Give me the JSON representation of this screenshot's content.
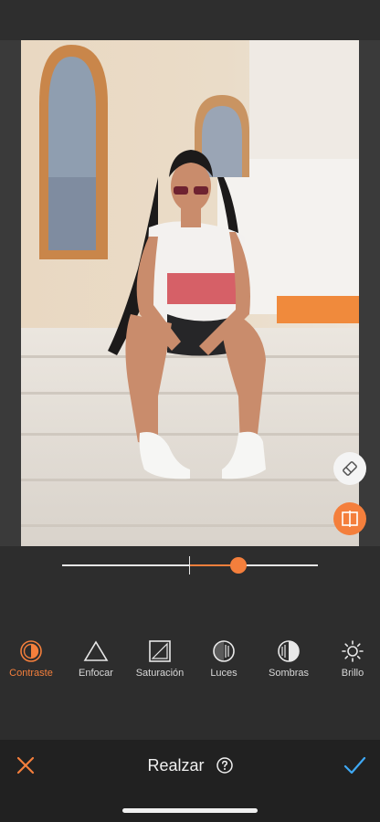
{
  "editor": {
    "title": "Realzar",
    "accent_color": "#f47f3c",
    "slider": {
      "value_fraction": 0.69,
      "center_fraction": 0.5
    }
  },
  "floating_buttons": [
    {
      "icon": "eraser-icon"
    },
    {
      "icon": "compare-split-icon"
    }
  ],
  "tools": [
    {
      "label": "Contraste",
      "icon": "contrast-icon",
      "active": true
    },
    {
      "label": "Enfocar",
      "icon": "triangle-icon",
      "active": false
    },
    {
      "label": "Saturación",
      "icon": "saturation-icon",
      "active": false
    },
    {
      "label": "Luces",
      "icon": "highlights-icon",
      "active": false
    },
    {
      "label": "Sombras",
      "icon": "shadows-icon",
      "active": false
    },
    {
      "label": "Brillo",
      "icon": "sun-icon",
      "active": false
    }
  ],
  "bottom_bar": {
    "cancel_icon": "close-icon",
    "confirm_icon": "check-icon",
    "help_icon": "help-icon"
  }
}
